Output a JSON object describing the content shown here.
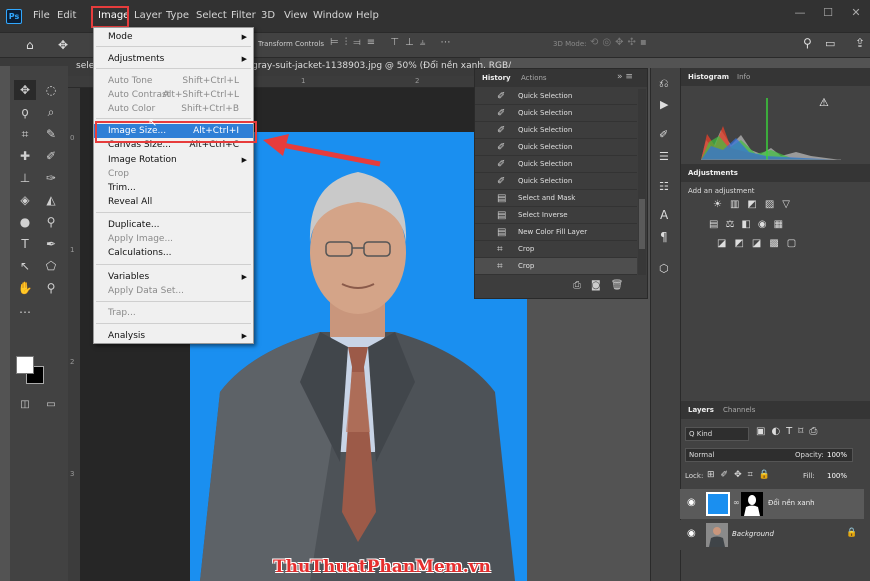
{
  "app": {
    "logo": "Ps",
    "window_controls": [
      "—",
      "☐",
      "✕"
    ]
  },
  "menubar": [
    "File",
    "Edit",
    "Image",
    "Layer",
    "Type",
    "Select",
    "Filter",
    "3D",
    "View",
    "Window",
    "Help"
  ],
  "options_bar": {
    "transform_label": "Transform Controls",
    "mode_label": "3D Mode:"
  },
  "document": {
    "tab_left": "selec",
    "tab_title": "gray-suit-jacket-1138903.jpg @ 50% (Đổi nền xanh, RGB/",
    "ruler_top": [
      "1",
      "2"
    ],
    "ruler_left": [
      "0",
      "1",
      "2",
      "3"
    ]
  },
  "image_menu": {
    "items": [
      {
        "label": "Mode",
        "shortcut": "",
        "submenu": true,
        "disabled": false
      },
      {
        "label": "Adjustments",
        "shortcut": "",
        "submenu": true,
        "disabled": false
      },
      {
        "label": "Auto Tone",
        "shortcut": "Shift+Ctrl+L",
        "submenu": false,
        "disabled": true
      },
      {
        "label": "Auto Contrast",
        "shortcut": "Alt+Shift+Ctrl+L",
        "submenu": false,
        "disabled": true
      },
      {
        "label": "Auto Color",
        "shortcut": "Shift+Ctrl+B",
        "submenu": false,
        "disabled": true
      },
      {
        "label": "Image Size...",
        "shortcut": "Alt+Ctrl+I",
        "submenu": false,
        "disabled": false
      },
      {
        "label": "Canvas Size...",
        "shortcut": "Alt+Ctrl+C",
        "submenu": false,
        "disabled": false
      },
      {
        "label": "Image Rotation",
        "shortcut": "",
        "submenu": true,
        "disabled": false
      },
      {
        "label": "Crop",
        "shortcut": "",
        "submenu": false,
        "disabled": true
      },
      {
        "label": "Trim...",
        "shortcut": "",
        "submenu": false,
        "disabled": false
      },
      {
        "label": "Reveal All",
        "shortcut": "",
        "submenu": false,
        "disabled": false
      },
      {
        "label": "Duplicate...",
        "shortcut": "",
        "submenu": false,
        "disabled": false
      },
      {
        "label": "Apply Image...",
        "shortcut": "",
        "submenu": false,
        "disabled": true
      },
      {
        "label": "Calculations...",
        "shortcut": "",
        "submenu": false,
        "disabled": false
      },
      {
        "label": "Variables",
        "shortcut": "",
        "submenu": true,
        "disabled": false
      },
      {
        "label": "Apply Data Set...",
        "shortcut": "",
        "submenu": false,
        "disabled": true
      },
      {
        "label": "Trap...",
        "shortcut": "",
        "submenu": false,
        "disabled": true
      },
      {
        "label": "Analysis",
        "shortcut": "",
        "submenu": true,
        "disabled": false
      }
    ]
  },
  "history": {
    "tabs": [
      "History",
      "Actions"
    ],
    "rows": [
      {
        "icon": "brush-icon",
        "label": "Quick Selection"
      },
      {
        "icon": "brush-icon",
        "label": "Quick Selection"
      },
      {
        "icon": "brush-icon",
        "label": "Quick Selection"
      },
      {
        "icon": "brush-icon",
        "label": "Quick Selection"
      },
      {
        "icon": "brush-icon",
        "label": "Quick Selection"
      },
      {
        "icon": "brush-icon",
        "label": "Quick Selection"
      },
      {
        "icon": "doc-icon",
        "label": "Select and Mask"
      },
      {
        "icon": "doc-icon",
        "label": "Select Inverse"
      },
      {
        "icon": "doc-icon",
        "label": "New Color Fill Layer"
      },
      {
        "icon": "crop-icon",
        "label": "Crop"
      },
      {
        "icon": "crop-icon",
        "label": "Crop"
      }
    ]
  },
  "histogram": {
    "tabs": [
      "Histogram",
      "Info"
    ]
  },
  "adjustments": {
    "title": "Adjustments",
    "subtitle": "Add an adjustment"
  },
  "layers": {
    "tabs": [
      "Layers",
      "Channels"
    ],
    "kind_label": "Q Kind",
    "blend_mode": "Normal",
    "opacity_label": "Opacity:",
    "opacity_value": "100%",
    "lock_label": "Lock:",
    "fill_label": "Fill:",
    "fill_value": "100%",
    "items": [
      {
        "name": "Đổi nền xanh",
        "italic": false
      },
      {
        "name": "Background",
        "italic": true
      }
    ]
  },
  "watermark": "ThuThuatPhanMem.vn"
}
